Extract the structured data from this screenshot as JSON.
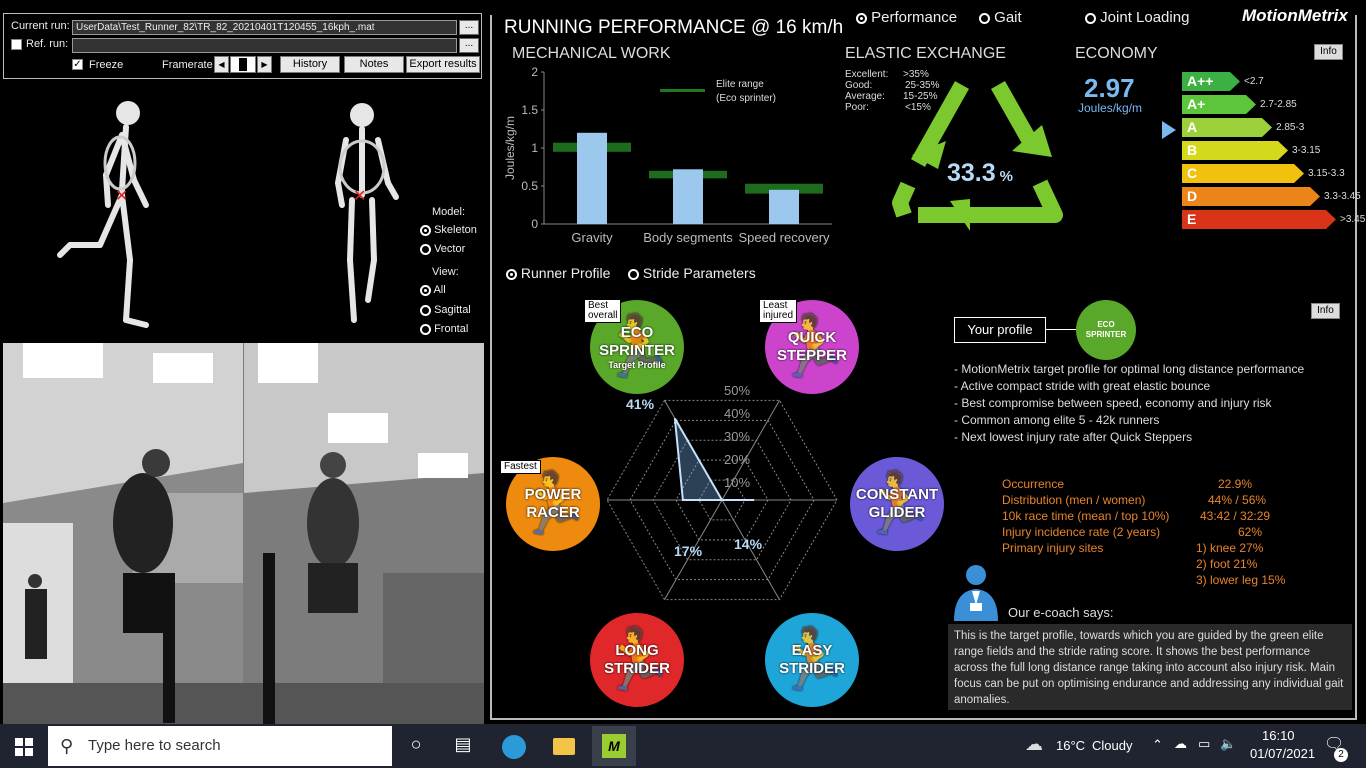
{
  "controls": {
    "current_run_label": "Current run:",
    "current_run_value": "UserData\\Test_Runner_82\\TR_82_20210401T120455_16kph_.mat",
    "ref_run_label": "Ref. run:",
    "ref_run_value": "",
    "browse_label": "...",
    "freeze_label": "Freeze",
    "framerate_label": "Framerate",
    "history_label": "History",
    "notes_label": "Notes",
    "export_label": "Export results"
  },
  "model": {
    "model_title": "Model:",
    "skeleton_label": "Skeleton",
    "vector_label": "Vector",
    "view_title": "View:",
    "all_label": "All",
    "sagittal_label": "Sagittal",
    "frontal_label": "Frontal"
  },
  "mode_tabs": {
    "performance": "Performance",
    "gait": "Gait",
    "joint_loading": "Joint Loading"
  },
  "brand": "MotionMetrix",
  "header": {
    "title": "RUNNING PERFORMANCE @ 16 km/h"
  },
  "mech": {
    "title": "MECHANICAL WORK",
    "legend_line1": "Elite range",
    "legend_line2": "(Eco sprinter)"
  },
  "chart_data": {
    "type": "bar",
    "title": "MECHANICAL WORK",
    "ylabel": "Joules/kg/m",
    "categories": [
      "Gravity",
      "Body segments",
      "Speed recovery"
    ],
    "values": [
      1.2,
      0.72,
      0.45
    ],
    "elite_range": [
      [
        0.95,
        1.07
      ],
      [
        0.6,
        0.7
      ],
      [
        0.4,
        0.53
      ]
    ],
    "ylim": [
      0,
      2
    ],
    "yticks": [
      "0",
      "0.5",
      "1",
      "1.5",
      "2"
    ],
    "bar_color": "#9cc8ee",
    "range_color": "#1d6b1d"
  },
  "elastic": {
    "title": "ELASTIC EXCHANGE",
    "value": "33.3",
    "unit": "%",
    "legend": [
      {
        "label": "Excellent:",
        "value": ">35%"
      },
      {
        "label": "Good:",
        "value": "25-35%"
      },
      {
        "label": "Average:",
        "value": "15-25%"
      },
      {
        "label": "Poor:",
        "value": "<15%"
      }
    ]
  },
  "economy": {
    "title": "ECONOMY",
    "value": "2.97",
    "unit": "Joules/kg/m",
    "info_label": "Info",
    "grades": [
      {
        "grade": "A++",
        "range": "<2.7",
        "color": "#3cb043"
      },
      {
        "grade": "A+",
        "range": "2.7-2.85",
        "color": "#5cc53c"
      },
      {
        "grade": "A",
        "range": "2.85-3",
        "color": "#9bd03a"
      },
      {
        "grade": "B",
        "range": "3-3.15",
        "color": "#d4d91c"
      },
      {
        "grade": "C",
        "range": "3.15-3.3",
        "color": "#f0c20e"
      },
      {
        "grade": "D",
        "range": "3.3-3.45",
        "color": "#ec8519"
      },
      {
        "grade": "E",
        "range": ">3.45",
        "color": "#d93417"
      }
    ]
  },
  "profile_tabs": {
    "runner_profile": "Runner Profile",
    "stride_parameters": "Stride Parameters"
  },
  "profiles": {
    "eco": {
      "name1": "ECO",
      "name2": "SPRINTER",
      "sub": "Target Profile",
      "tag1": "Best",
      "tag2": "overall",
      "color": "#5aa82a"
    },
    "quick": {
      "name1": "QUICK",
      "name2": "STEPPER",
      "tag1": "Least",
      "tag2": "injured",
      "color": "#cc44cc"
    },
    "power": {
      "name1": "POWER",
      "name2": "RACER",
      "tag1": "Fastest",
      "color": "#ee8a0e"
    },
    "constant": {
      "name1": "CONSTANT",
      "name2": "GLIDER",
      "color": "#6a5ad8"
    },
    "long": {
      "name1": "LONG",
      "name2": "STRIDER",
      "color": "#e0282a"
    },
    "easy": {
      "name1": "EASY",
      "name2": "STRIDER",
      "color": "#1fa6d8"
    }
  },
  "radar": {
    "ticks": [
      "50%",
      "40%",
      "30%",
      "20%",
      "10%"
    ],
    "eco_value": 41,
    "constant_value": 14,
    "easy_value": 0,
    "long_value": 0,
    "power_value": 17,
    "quick_value": 0,
    "eco_label": "41%",
    "constant_label": "14%",
    "power_label": "17%"
  },
  "your_profile": {
    "label": "Your profile",
    "badge_line1": "ECO",
    "badge_line2": "SPRINTER",
    "info_label": "Info",
    "bullets": [
      "- MotionMetrix target profile for optimal long distance performance",
      "- Active compact stride with great elastic bounce",
      "- Best compromise between speed, economy and injury risk",
      "- Common among elite 5 - 42k runners",
      "- Next lowest injury rate after Quick Steppers"
    ],
    "stats": [
      {
        "label": "Occurrence",
        "value": "22.9%"
      },
      {
        "label": "Distribution (men / women)",
        "value": "44% / 56%"
      },
      {
        "label": "10k race time (mean / top 10%)",
        "value": "43:42 / 32:29"
      },
      {
        "label": "Injury incidence rate (2 years)",
        "value": "62%"
      },
      {
        "label": "Primary injury sites",
        "value": "1) knee 27%"
      },
      {
        "label": "",
        "value": "2) foot 21%"
      },
      {
        "label": "",
        "value": "3) lower leg 15%"
      }
    ],
    "coach_title": "Our e-coach says:",
    "coach_text": "This is the target profile, towards which you are guided by the green elite range fields and the stride rating score. It shows the best performance across the full long distance range taking into account also injury risk. Main focus can be put on optimising endurance and addressing any individual gait anomalies."
  },
  "taskbar": {
    "search_placeholder": "Type here to search",
    "weather_temp": "16°C",
    "weather_text": "Cloudy",
    "time": "16:10",
    "date": "01/07/2021",
    "notif_count": "2"
  }
}
